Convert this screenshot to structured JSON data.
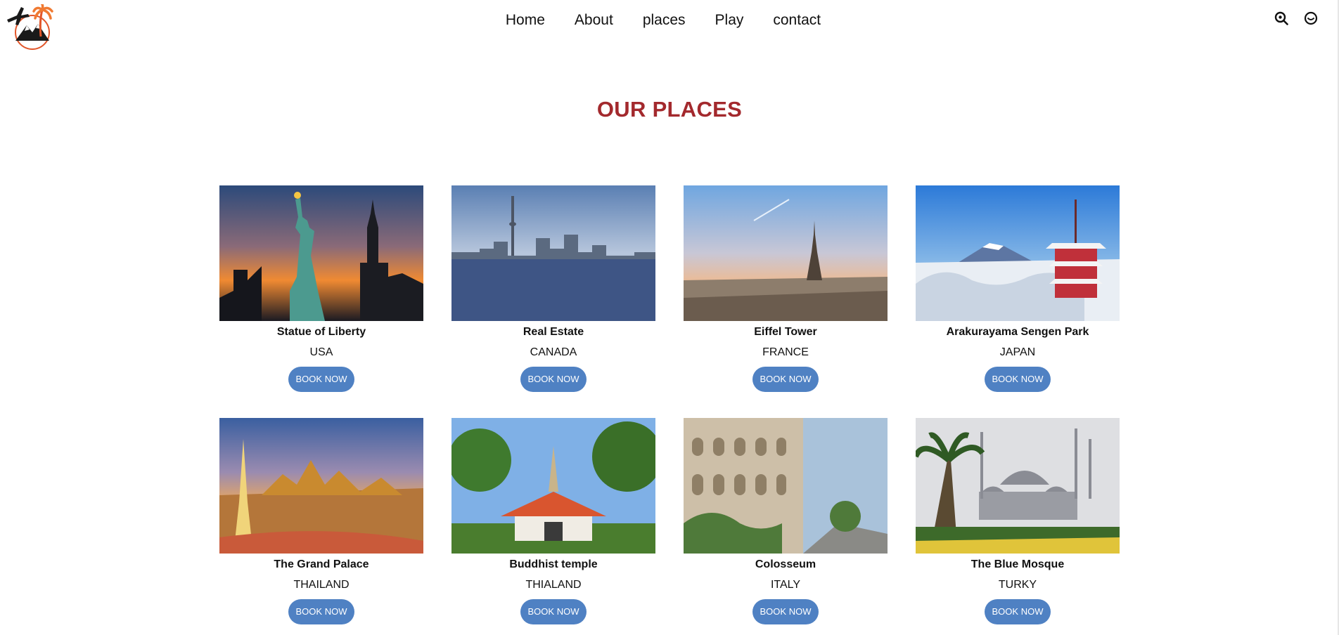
{
  "brand": {
    "logo_icon": "airplane-palm-mountain-logo"
  },
  "nav": {
    "items": [
      {
        "label": "Home"
      },
      {
        "label": "About"
      },
      {
        "label": "places"
      },
      {
        "label": "Play"
      },
      {
        "label": "contact"
      }
    ]
  },
  "tools": {
    "search_icon": "search-icon",
    "user_icon": "user-icon"
  },
  "section": {
    "title": "OUR PLACES"
  },
  "places": [
    {
      "name": "Statue of Liberty",
      "country": "USA",
      "button": "BOOK NOW"
    },
    {
      "name": "Real Estate",
      "country": "CANADA",
      "button": "BOOK NOW"
    },
    {
      "name": "Eiffel Tower",
      "country": "FRANCE",
      "button": "BOOK NOW"
    },
    {
      "name": "Arakurayama Sengen Park",
      "country": "JAPAN",
      "button": "BOOK NOW"
    },
    {
      "name": "The Grand Palace",
      "country": "THAILAND",
      "button": "BOOK NOW"
    },
    {
      "name": "Buddhist temple",
      "country": "THIALAND",
      "button": "BOOK NOW"
    },
    {
      "name": "Colosseum",
      "country": "ITALY",
      "button": "BOOK NOW"
    },
    {
      "name": "The Blue Mosque",
      "country": "TURKY",
      "button": "BOOK NOW"
    }
  ],
  "colors": {
    "title": "#a3292d",
    "button": "#4f81c3"
  }
}
